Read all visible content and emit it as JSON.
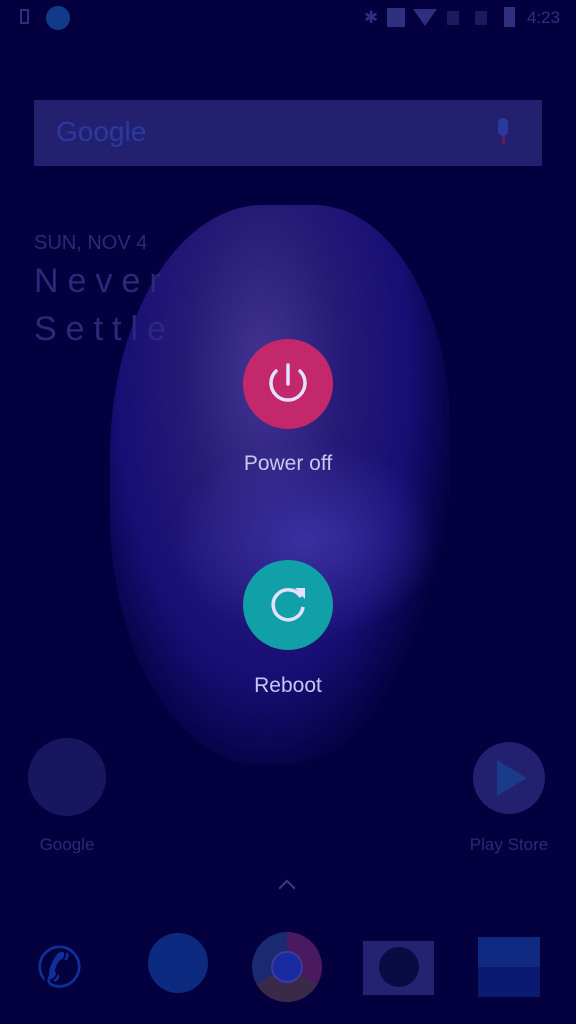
{
  "status_bar": {
    "time": "4:23",
    "icons": [
      "screenshot-icon",
      "globe-icon",
      "bluetooth-icon",
      "nfc-icon",
      "wifi-icon",
      "sim1-icon",
      "sim2-icon",
      "battery-icon"
    ]
  },
  "search": {
    "logo": "Google",
    "icon": "mic-icon"
  },
  "clock_widget": {
    "date": "SUN, NOV 4",
    "line1": "Never",
    "line2": "Settle"
  },
  "power_menu": {
    "power_off": {
      "label": "Power off",
      "icon": "power-icon",
      "color": "#c2286a"
    },
    "reboot": {
      "label": "Reboot",
      "icon": "refresh-icon",
      "color": "#12a0a8"
    }
  },
  "apps": [
    {
      "label": "Google"
    },
    {
      "label": "Play Store"
    }
  ],
  "dock": [
    "phone",
    "messages",
    "chrome",
    "camera",
    "gallery"
  ],
  "colors": {
    "scrim": "#04003f"
  }
}
